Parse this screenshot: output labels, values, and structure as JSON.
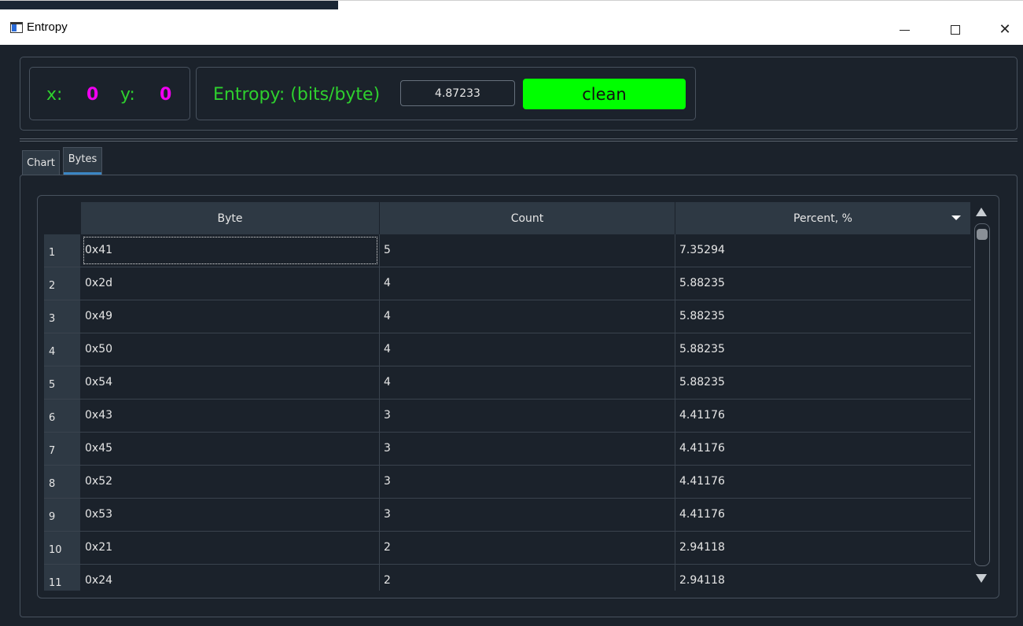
{
  "window": {
    "title": "Entropy",
    "controls": [
      "minimize",
      "maximize",
      "close"
    ]
  },
  "header": {
    "x_label": "x:",
    "x_value": "0",
    "y_label": "y:",
    "y_value": "0",
    "entropy_label": "Entropy: (bits/byte)",
    "entropy_value": "4.87233",
    "status_button": "clean",
    "colors": {
      "label": "#2ed02e",
      "value": "#f000f0",
      "status_bg": "#00ff00"
    }
  },
  "tabs": [
    {
      "label": "Chart",
      "active": false
    },
    {
      "label": "Bytes",
      "active": true
    }
  ],
  "table": {
    "columns": [
      "Byte",
      "Count",
      "Percent, %"
    ],
    "sort_column": "Percent, %",
    "sort_order": "descending",
    "rows": [
      {
        "num": "1",
        "byte": "0x41",
        "count": "5",
        "percent": "7.35294"
      },
      {
        "num": "2",
        "byte": "0x2d",
        "count": "4",
        "percent": "5.88235"
      },
      {
        "num": "3",
        "byte": "0x49",
        "count": "4",
        "percent": "5.88235"
      },
      {
        "num": "4",
        "byte": "0x50",
        "count": "4",
        "percent": "5.88235"
      },
      {
        "num": "5",
        "byte": "0x54",
        "count": "4",
        "percent": "5.88235"
      },
      {
        "num": "6",
        "byte": "0x43",
        "count": "3",
        "percent": "4.41176"
      },
      {
        "num": "7",
        "byte": "0x45",
        "count": "3",
        "percent": "4.41176"
      },
      {
        "num": "8",
        "byte": "0x52",
        "count": "3",
        "percent": "4.41176"
      },
      {
        "num": "9",
        "byte": "0x53",
        "count": "3",
        "percent": "4.41176"
      },
      {
        "num": "10",
        "byte": "0x21",
        "count": "2",
        "percent": "2.94118"
      },
      {
        "num": "11",
        "byte": "0x24",
        "count": "2",
        "percent": "2.94118"
      }
    ]
  }
}
